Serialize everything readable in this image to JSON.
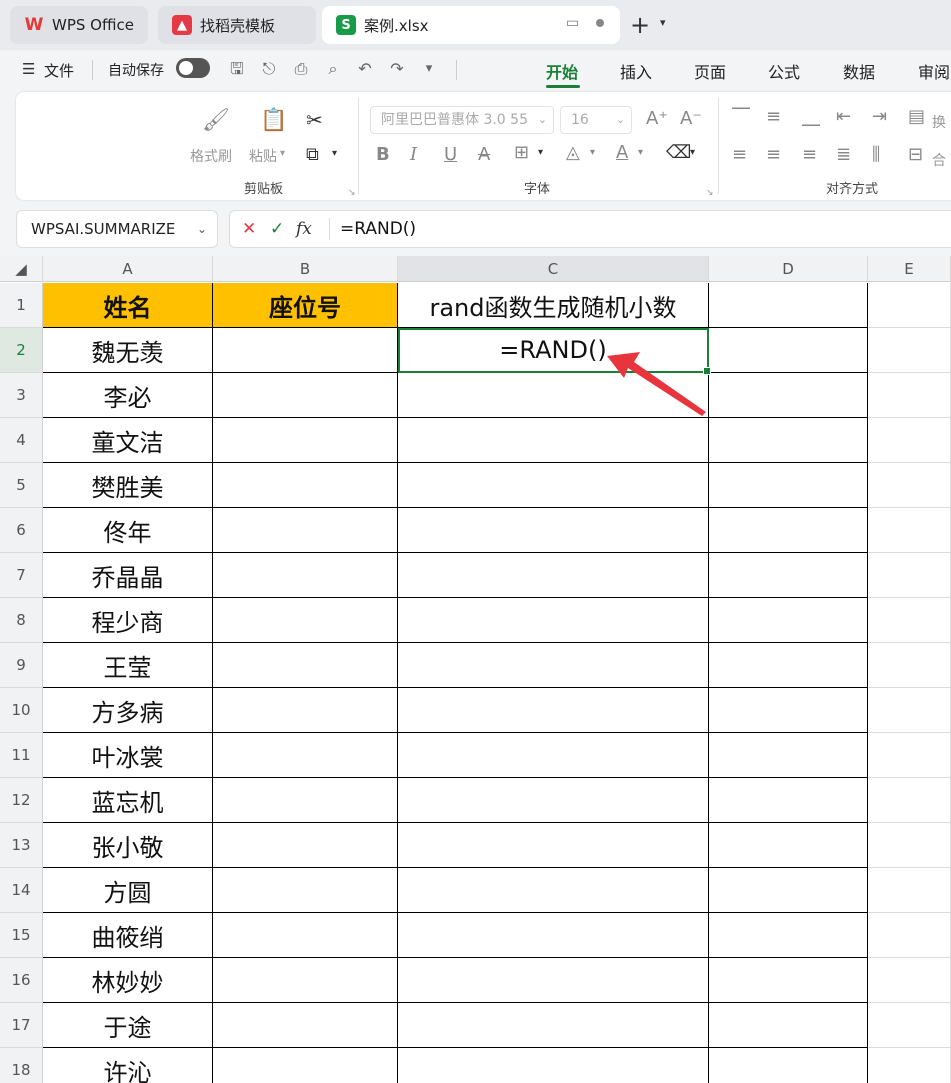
{
  "tabs": [
    {
      "label": "WPS Office",
      "icon": "wps-logo-icon"
    },
    {
      "label": "找稻壳模板",
      "icon": "docer-logo-icon"
    },
    {
      "label": "案例.xlsx",
      "icon": "spreadsheet-s-icon"
    }
  ],
  "menu": {
    "file_label": "文件",
    "autosave_label": "自动保存",
    "ribbon_tabs": [
      "开始",
      "插入",
      "页面",
      "公式",
      "数据",
      "审阅"
    ]
  },
  "ribbon": {
    "format_painter": "格式刷",
    "paste": "粘贴",
    "clipboard_group": "剪贴板",
    "font_name": "阿里巴巴普惠体 3.0 55",
    "font_size": "16",
    "font_group": "字体",
    "align_group": "对齐方式",
    "wrap_label": "换",
    "merge_label": "合"
  },
  "formula_bar": {
    "name_box": "WPSAI.SUMMARIZE",
    "fx_label": "fx",
    "formula": "=RAND()"
  },
  "sheet": {
    "columns": [
      "A",
      "B",
      "C",
      "D",
      "E"
    ],
    "header_row": {
      "A": "姓名",
      "B": "座位号",
      "C": "rand函数生成随机小数"
    },
    "active_cell_text": "=RAND()",
    "names": [
      "魏无羡",
      "李必",
      "童文洁",
      "樊胜美",
      "佟年",
      "乔晶晶",
      "程少商",
      "王莹",
      "方多病",
      "叶冰裳",
      "蓝忘机",
      "张小敬",
      "方圆",
      "曲筱绡",
      "林妙妙",
      "于途",
      "许沁"
    ],
    "row_numbers": [
      "1",
      "2",
      "3",
      "4",
      "5",
      "6",
      "7",
      "8",
      "9",
      "10",
      "11",
      "12",
      "13",
      "14",
      "15",
      "16",
      "17",
      "18"
    ]
  },
  "colors": {
    "accent": "#1a7f37",
    "header_fill": "#ffc000",
    "arrow": "#e8343c"
  }
}
